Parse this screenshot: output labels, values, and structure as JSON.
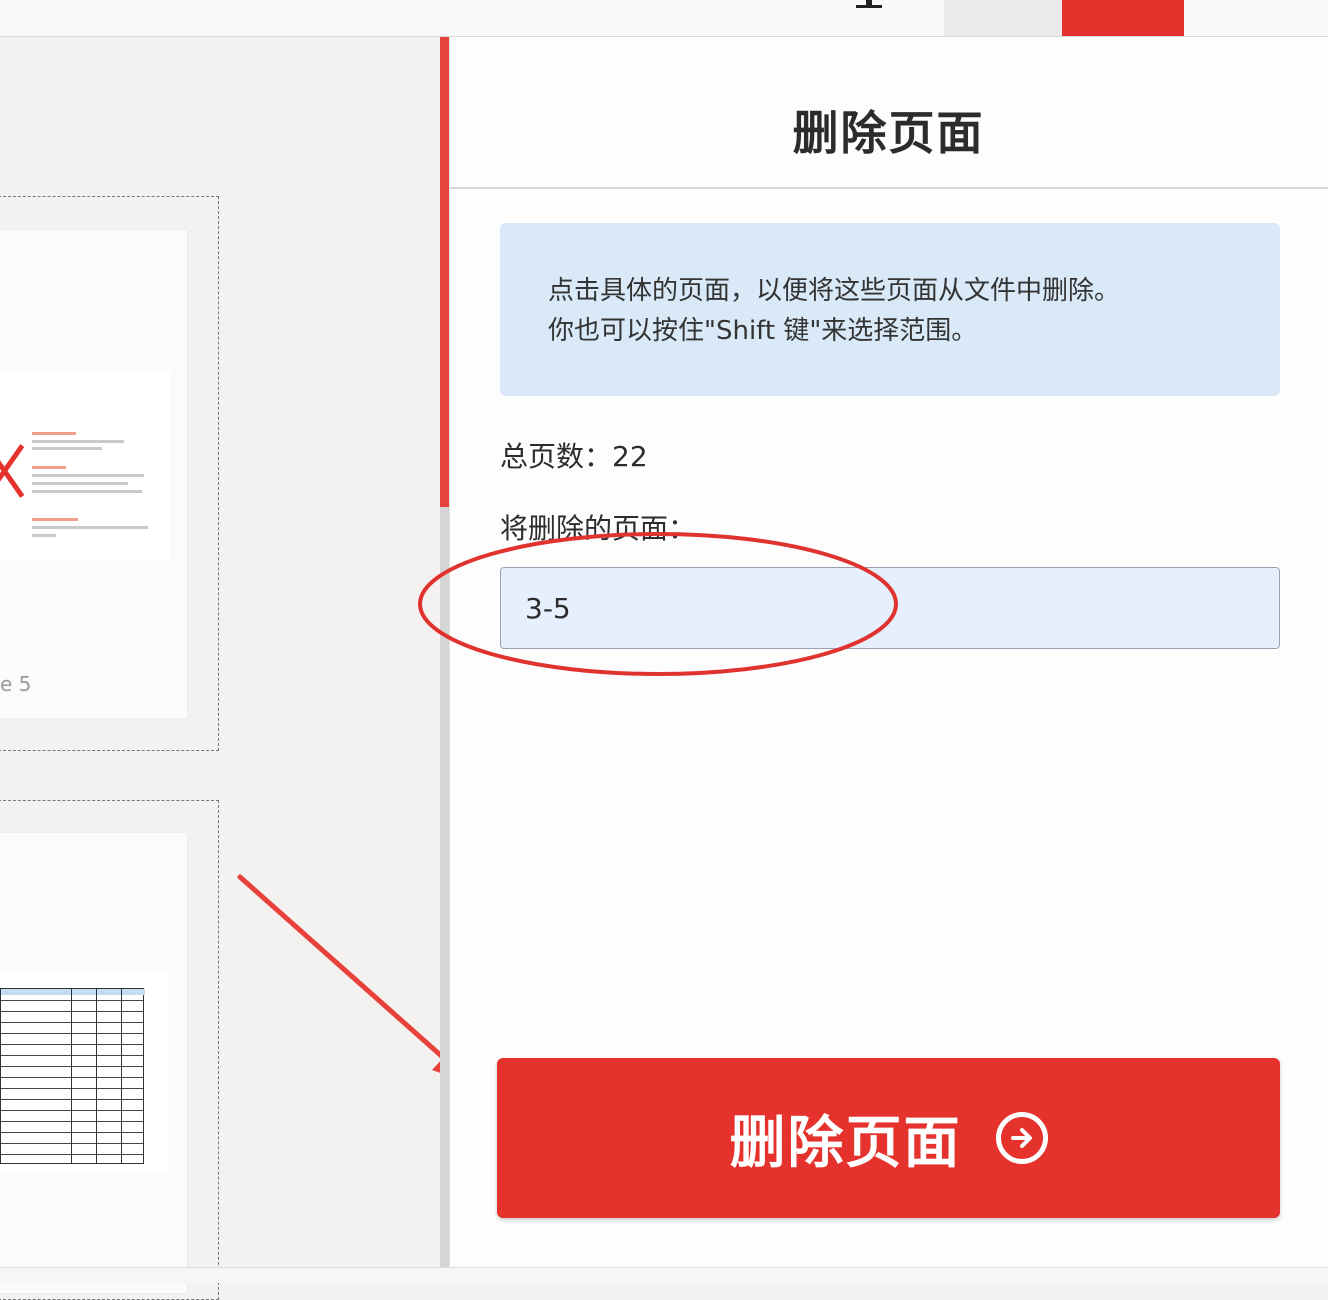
{
  "sidebar": {
    "title": "删除页面",
    "instructions": [
      "点击具体的页面，以便将这些页面从文件中删除。",
      "你也可以按住\"Shift 键\"来选择范围。"
    ],
    "total_pages_text": "总页数：22",
    "pages_to_delete_label": "将删除的页面：",
    "pages_to_delete_value": "3-5",
    "delete_button_label": "删除页面"
  },
  "thumbnails": {
    "page_label_partial": "e 5"
  },
  "colors": {
    "accent": "#e5322d",
    "info_box": "#d9e9f7",
    "input_bg": "#e6effd"
  },
  "icons": {
    "delete_button_icon": "arrow-circle-right-icon",
    "deleted_mark": "x-mark-icon"
  }
}
